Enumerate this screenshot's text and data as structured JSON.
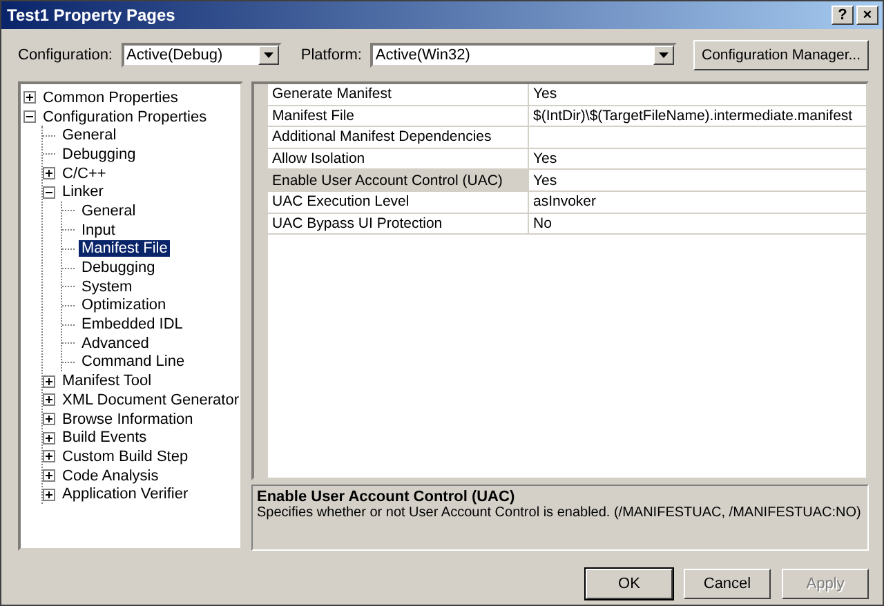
{
  "window": {
    "title": "Test1 Property Pages",
    "help_button": "?",
    "close_button": "×"
  },
  "configuration": {
    "label": "Configuration:",
    "value": "Active(Debug)"
  },
  "platform": {
    "label": "Platform:",
    "value": "Active(Win32)"
  },
  "configuration_manager_button": "Configuration Manager...",
  "tree": [
    {
      "label": "Common Properties",
      "expanded": false,
      "selected": false
    },
    {
      "label": "Configuration Properties",
      "expanded": true,
      "selected": false,
      "children": [
        {
          "label": "General",
          "selected": false
        },
        {
          "label": "Debugging",
          "selected": false
        },
        {
          "label": "C/C++",
          "expanded": false,
          "selected": false
        },
        {
          "label": "Linker",
          "expanded": true,
          "selected": false,
          "children": [
            {
              "label": "General",
              "selected": false
            },
            {
              "label": "Input",
              "selected": false
            },
            {
              "label": "Manifest File",
              "selected": true
            },
            {
              "label": "Debugging",
              "selected": false
            },
            {
              "label": "System",
              "selected": false
            },
            {
              "label": "Optimization",
              "selected": false
            },
            {
              "label": "Embedded IDL",
              "selected": false
            },
            {
              "label": "Advanced",
              "selected": false
            },
            {
              "label": "Command Line",
              "selected": false
            }
          ]
        },
        {
          "label": "Manifest Tool",
          "expanded": false,
          "selected": false
        },
        {
          "label": "XML Document Generator",
          "expanded": false,
          "selected": false
        },
        {
          "label": "Browse Information",
          "expanded": false,
          "selected": false
        },
        {
          "label": "Build Events",
          "expanded": false,
          "selected": false
        },
        {
          "label": "Custom Build Step",
          "expanded": false,
          "selected": false
        },
        {
          "label": "Code Analysis",
          "expanded": false,
          "selected": false
        },
        {
          "label": "Application Verifier",
          "expanded": false,
          "selected": false
        }
      ]
    }
  ],
  "properties": [
    {
      "name": "Generate Manifest",
      "value": "Yes",
      "selected": false
    },
    {
      "name": "Manifest File",
      "value": "$(IntDir)\\$(TargetFileName).intermediate.manifest",
      "selected": false
    },
    {
      "name": "Additional Manifest Dependencies",
      "selected": false
    },
    {
      "name": "Allow Isolation",
      "value": "Yes",
      "selected": false
    },
    {
      "name": "Enable User Account Control (UAC)",
      "value": "Yes",
      "selected": true
    },
    {
      "name": "UAC Execution Level",
      "value": "asInvoker",
      "selected": false
    },
    {
      "name": "UAC Bypass UI Protection",
      "value": "No",
      "selected": false
    }
  ],
  "description": {
    "title": "Enable User Account Control (UAC)",
    "text": "Specifies whether or not User Account Control is enabled.  (/MANIFESTUAC, /MANIFESTUAC:NO)"
  },
  "buttons": [
    {
      "label": "OK",
      "default": true,
      "disabled": false
    },
    {
      "label": "Cancel",
      "default": false,
      "disabled": false
    },
    {
      "label": "Apply",
      "default": false,
      "disabled": true
    }
  ]
}
